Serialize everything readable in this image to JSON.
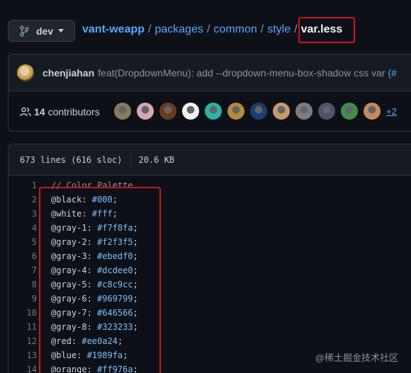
{
  "branch": {
    "label": "dev"
  },
  "breadcrumb": {
    "repo": "vant-weapp",
    "parts": [
      "packages",
      "common",
      "style"
    ],
    "file": "var.less",
    "separator": "/"
  },
  "commit": {
    "author": "chenjiahan",
    "message": "feat(DropdownMenu): add --dropdown-menu-box-shadow css var ",
    "link": "(#"
  },
  "contributors": {
    "count": "14",
    "label": "contributors",
    "more": "+2",
    "avatar_colors": [
      "#8a7a5c",
      "#d7a7b8",
      "#6b3b1f",
      "#f2f2f2",
      "#2bb3a5",
      "#b58a3c",
      "#1e3c6e",
      "#c99a6b",
      "#7d7d7d",
      "#4b5563",
      "#3f8f4a",
      "#c78a5b"
    ]
  },
  "file_info": {
    "lines": "673 lines (616 sloc)",
    "size": "20.6 KB"
  },
  "code_lines": [
    {
      "num": "1",
      "name": "// Color Palette",
      "value": "",
      "comment": true
    },
    {
      "num": "2",
      "name": "@black: ",
      "value": "#000",
      "tail": ";"
    },
    {
      "num": "3",
      "name": "@white: ",
      "value": "#fff",
      "tail": ";"
    },
    {
      "num": "4",
      "name": "@gray-1: ",
      "value": "#f7f8fa",
      "tail": ";"
    },
    {
      "num": "5",
      "name": "@gray-2: ",
      "value": "#f2f3f5",
      "tail": ";"
    },
    {
      "num": "6",
      "name": "@gray-3: ",
      "value": "#ebedf0",
      "tail": ";"
    },
    {
      "num": "7",
      "name": "@gray-4: ",
      "value": "#dcdee0",
      "tail": ";"
    },
    {
      "num": "8",
      "name": "@gray-5: ",
      "value": "#c8c9cc",
      "tail": ";"
    },
    {
      "num": "9",
      "name": "@gray-6: ",
      "value": "#969799",
      "tail": ";"
    },
    {
      "num": "10",
      "name": "@gray-7: ",
      "value": "#646566",
      "tail": ";"
    },
    {
      "num": "11",
      "name": "@gray-8: ",
      "value": "#323233",
      "tail": ";"
    },
    {
      "num": "12",
      "name": "@red: ",
      "value": "#ee0a24",
      "tail": ";"
    },
    {
      "num": "13",
      "name": "@blue: ",
      "value": "#1989fa",
      "tail": ";"
    },
    {
      "num": "14",
      "name": "@orange: ",
      "value": "#ff976a",
      "tail": ";"
    }
  ],
  "watermark": "@稀土掘金技术社区",
  "colors": {
    "highlight": "#d0141a",
    "link": "#58a6ff",
    "background": "#0d1117"
  }
}
